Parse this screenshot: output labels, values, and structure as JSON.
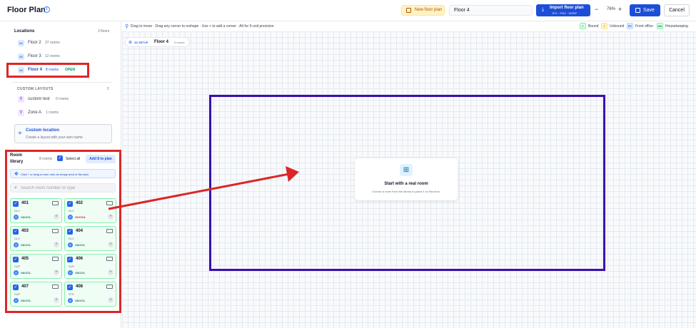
{
  "header": {
    "title": "Floor Plan",
    "info_icon": "i",
    "new_floor_plan": "New floor plan",
    "floor_name_value": "Floor 4",
    "import_label": "Import floor plan",
    "import_sub": "JPG · PNG · WEBP",
    "zoom_minus": "−",
    "zoom": "76%",
    "zoom_plus": "+",
    "save": "Save",
    "cancel": "Cancel"
  },
  "sidebar": {
    "locations_title": "Locations",
    "locations_count": "3 floors",
    "floors": [
      {
        "code": "02",
        "name": "Floor 2",
        "rooms": "37 rooms"
      },
      {
        "code": "03",
        "name": "Floor 3",
        "rooms": "12 rooms"
      },
      {
        "code": "03",
        "name": "Floor 4",
        "rooms": "8 rooms",
        "badge": "OPEN"
      }
    ],
    "custom_layouts_title": "CUSTOM LAYOUTS",
    "custom_layouts_count": "2",
    "custom_layouts": [
      {
        "name": "custom test",
        "rooms": "0 rooms"
      },
      {
        "name": "Zone A",
        "rooms": "1 rooms"
      }
    ],
    "custom_location_title": "Custom location",
    "custom_location_sub": "Create a layout with your own name"
  },
  "room_library": {
    "title": "Room library",
    "count": "8 rooms",
    "select_all": "Select all",
    "add_button": "Add 8 to plan",
    "hint": "Click + or drag a room onto an empty area of the plan.",
    "search_placeholder": "Search room number or type",
    "rooms": [
      {
        "number": "401",
        "type": "DLX",
        "status": "VAC/CL",
        "status_color": "#047857"
      },
      {
        "number": "402",
        "type": "DLX",
        "status": "OCC/CL",
        "status_color": "#b91c1c"
      },
      {
        "number": "403",
        "type": "DLX",
        "status": "VAC/CL",
        "status_color": "#047857"
      },
      {
        "number": "404",
        "type": "DLX",
        "status": "VAC/CL",
        "status_color": "#047857"
      },
      {
        "number": "405",
        "type": "SUP",
        "status": "VAC/CL",
        "status_color": "#047857"
      },
      {
        "number": "406",
        "type": "SUP",
        "status": "VAC/CL",
        "status_color": "#047857"
      },
      {
        "number": "407",
        "type": "SUP",
        "status": "VAC/CL",
        "status_color": "#047857"
      },
      {
        "number": "408",
        "type": "STE",
        "status": "VAC/CL",
        "status_color": "#047857"
      }
    ]
  },
  "canvas": {
    "hint": "Drag to move · Drag any corner to reshape · Use + to add a corner · Alt for 5-unit precision",
    "chip_setup": "2D SETUP",
    "chip_floor": "Floor 4",
    "chip_rooms": "0 rooms",
    "legend": [
      {
        "badge": "✓",
        "label": "Bound",
        "bg": "#dcfce7",
        "fg": "#15803d"
      },
      {
        "badge": "!",
        "label": "Unbound",
        "bg": "#fef3c7",
        "fg": "#b45309"
      },
      {
        "badge": "FC",
        "label": "Front office",
        "bg": "#dbeafe",
        "fg": "#1d4ed8"
      },
      {
        "badge": "HK",
        "label": "Housekeeping",
        "bg": "#dcfce7",
        "fg": "#15803d"
      }
    ],
    "empty_title": "Start with a real room",
    "empty_sub": "Choose a room from the library to place it on this floor."
  },
  "colors": {
    "accent": "#1d4ed8",
    "highlight": "#dc2626",
    "plan_outline": "#3b0fae"
  }
}
